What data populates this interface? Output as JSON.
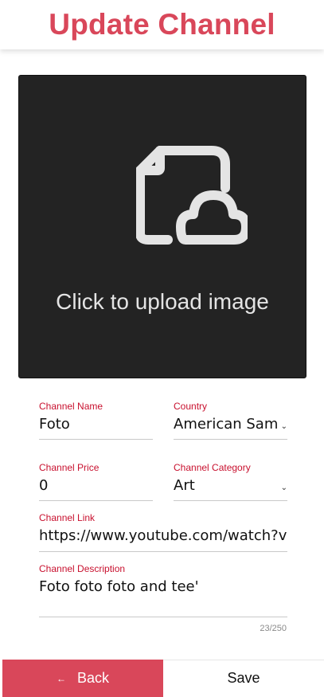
{
  "header": {
    "title": "Update Channel"
  },
  "upload": {
    "text": "Click to upload image"
  },
  "form": {
    "channel_name": {
      "label": "Channel Name",
      "value": "Foto"
    },
    "country": {
      "label": "Country",
      "value": "American Samoa"
    },
    "channel_price": {
      "label": "Channel Price",
      "value": "0"
    },
    "channel_category": {
      "label": "Channel Category",
      "value": "Art"
    },
    "channel_link": {
      "label": "Channel Link",
      "value": "https://www.youtube.com/watch?v=d"
    },
    "channel_description": {
      "label": "Channel Description",
      "value": "Foto foto foto and tee'",
      "counter": "23/250"
    }
  },
  "footer": {
    "back_label": "Back",
    "save_label": "Save"
  },
  "colors": {
    "accent": "#d9475a",
    "label": "#c8102e",
    "upload_bg": "#232323"
  },
  "icons": {
    "upload": "file-cloud-icon",
    "back": "arrow-left-icon",
    "dropdown": "chevron-down-icon"
  }
}
